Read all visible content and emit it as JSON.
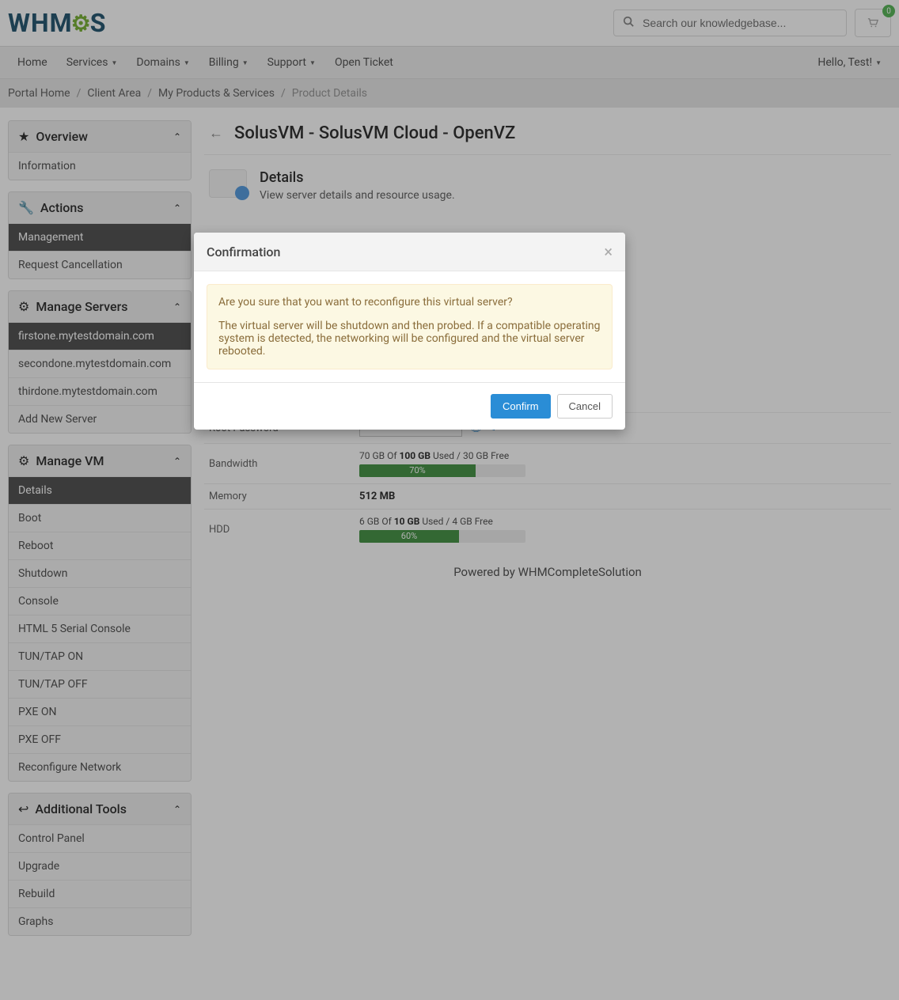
{
  "header": {
    "logo_prefix": "WHM",
    "logo_suffix": "S",
    "search_placeholder": "Search our knowledgebase...",
    "cart_count": "0"
  },
  "nav": {
    "items": [
      "Home",
      "Services",
      "Domains",
      "Billing",
      "Support",
      "Open Ticket"
    ],
    "greeting": "Hello, Test!"
  },
  "breadcrumb": {
    "items": [
      "Portal Home",
      "Client Area",
      "My Products & Services",
      "Product Details"
    ]
  },
  "sidebar": {
    "overview": {
      "title": "Overview",
      "items": [
        "Information"
      ]
    },
    "actions": {
      "title": "Actions",
      "items": [
        "Management",
        "Request Cancellation"
      ],
      "active": 0
    },
    "servers": {
      "title": "Manage Servers",
      "items": [
        "firstone.mytestdomain.com",
        "secondone.mytestdomain.com",
        "thirdone.mytestdomain.com",
        "Add New Server"
      ],
      "active": 0
    },
    "vm": {
      "title": "Manage VM",
      "items": [
        "Details",
        "Boot",
        "Reboot",
        "Shutdown",
        "Console",
        "HTML 5 Serial Console",
        "TUN/TAP ON",
        "TUN/TAP OFF",
        "PXE ON",
        "PXE OFF",
        "Reconfigure Network"
      ],
      "active": 0
    },
    "tools": {
      "title": "Additional Tools",
      "items": [
        "Control Panel",
        "Upgrade",
        "Rebuild",
        "Graphs"
      ]
    }
  },
  "page": {
    "title": "SolusVM - SolusVM Cloud - OpenVZ",
    "section_title": "Details",
    "section_desc": "View server details and resource usage."
  },
  "details": {
    "root_password_label": "Root Password",
    "root_password_value": "••••••••",
    "bandwidth_label": "Bandwidth",
    "bandwidth_text_pre": "70 GB Of ",
    "bandwidth_text_bold": "100 GB",
    "bandwidth_text_post": " Used / 30 GB Free",
    "bandwidth_pct": "70%",
    "memory_label": "Memory",
    "memory_value": "512 MB",
    "hdd_label": "HDD",
    "hdd_text_pre": "6 GB Of ",
    "hdd_text_bold": "10 GB",
    "hdd_text_post": " Used / 4 GB Free",
    "hdd_pct": "60%"
  },
  "footer": {
    "text": "Powered by WHMCompleteSolution"
  },
  "modal": {
    "title": "Confirmation",
    "msg1": "Are you sure that you want to reconfigure this virtual server?",
    "msg2": "The virtual server will be shutdown and then probed. If a compatible operating system is detected, the networking will be configured and the virtual server rebooted.",
    "confirm": "Confirm",
    "cancel": "Cancel"
  }
}
